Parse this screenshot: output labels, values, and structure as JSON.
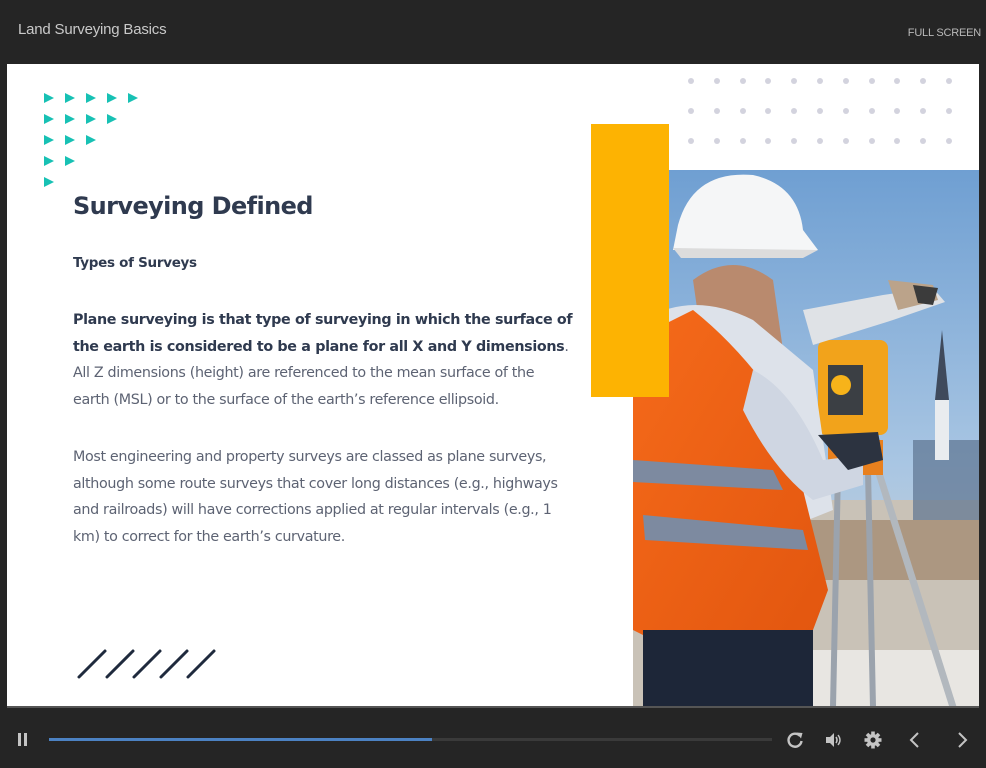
{
  "header": {
    "course_title": "Land Surveying Basics",
    "fullscreen_label": "FULL SCREEN"
  },
  "slide": {
    "title": "Surveying Defined",
    "subtitle": "Types of Surveys",
    "paragraph1": {
      "bold": "Plane surveying is that type of surveying in which the surface of the earth is considered to be a plane for all X and Y dimensions",
      "rest": ". All Z dimensions (height) are referenced to the mean surface of the earth (MSL) or to the surface of the earth’s reference ellipsoid."
    },
    "paragraph2": "Most engineering and property surveys are classed as plane surveys, although some route surveys that cover long distances (e.g., highways and railroads) will have corrections applied at regular intervals (e.g., 1 km) to correct for the earth’s curvature.",
    "image_description": "Surveyor in white hard hat and orange safety vest pointing while using a total station on a tripod",
    "decor": {
      "arrow_rows": [
        5,
        4,
        3,
        2,
        1
      ],
      "dot_rows": 3,
      "dot_cols": 11,
      "slash_count": 5
    }
  },
  "player": {
    "progress_percent": 53,
    "icons": {
      "pause": "pause-icon",
      "replay": "replay-icon",
      "volume": "volume-icon",
      "settings": "gear-icon",
      "prev": "chevron-left-icon",
      "next": "chevron-right-icon"
    }
  },
  "colors": {
    "accent_teal": "#17c1b4",
    "accent_yellow": "#fdb302",
    "heading_navy": "#2f3a4f",
    "progress_blue": "#4c82c3",
    "chrome_bg": "#252525"
  }
}
